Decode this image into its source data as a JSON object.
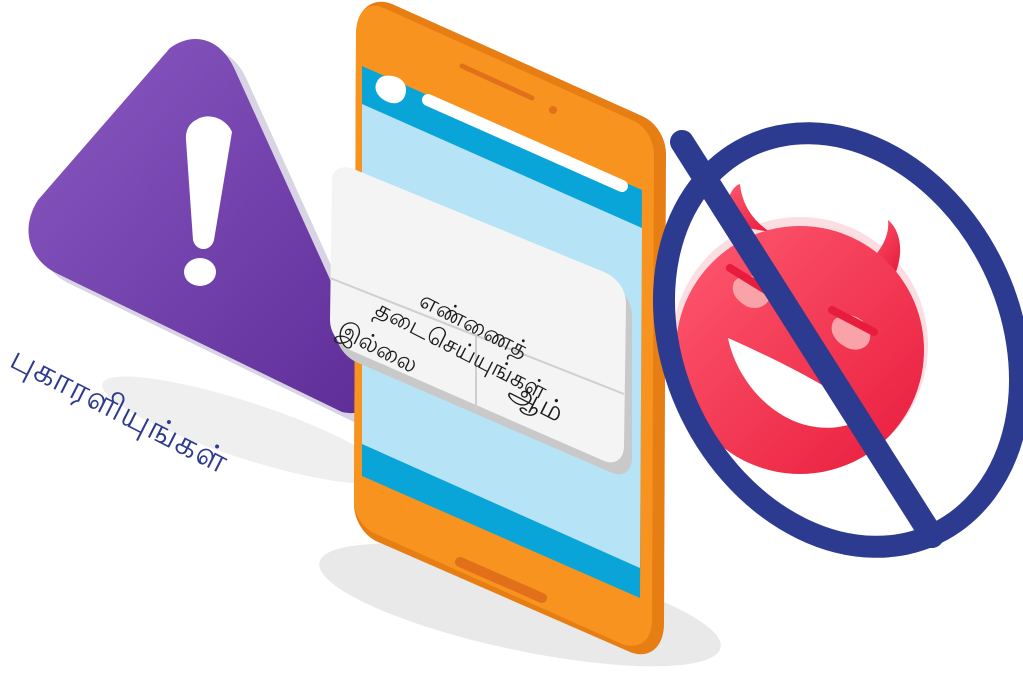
{
  "labels": {
    "report": "புகாரளியுங்கள்"
  },
  "dialog": {
    "title": "எண்ணைத் தடைசெய்யுங்கள்",
    "no_label": "இல்லை",
    "yes_label": "ஆம்"
  },
  "icons": {
    "warning": "warning-triangle-icon",
    "devil": "devil-face-icon",
    "prohibited": "prohibited-sign-icon",
    "phone": "smartphone-icon"
  },
  "colors": {
    "warning_purple": "#6a3aa6",
    "phone_orange": "#f7931e",
    "screen_blue": "#0aa5d8",
    "screen_light": "#b6e4f6",
    "devil_red": "#f2344f",
    "ban_navy": "#2c3a8f",
    "text_dark": "#1c1c1c"
  }
}
